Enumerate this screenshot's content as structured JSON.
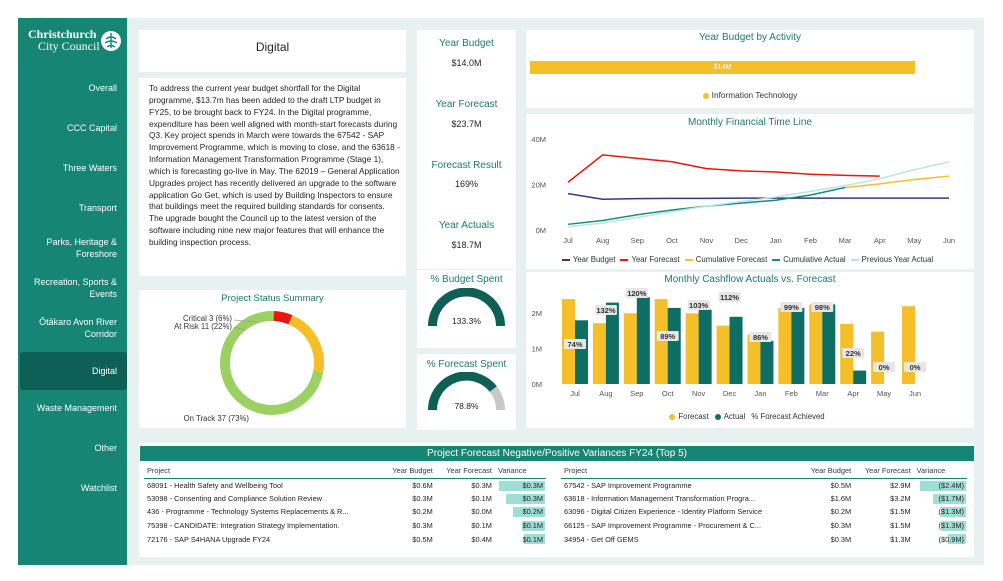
{
  "logo": {
    "line1": "Christchurch",
    "line2": "City Council"
  },
  "nav": [
    {
      "label": "Overall",
      "active": false
    },
    {
      "label": "CCC Capital",
      "active": false
    },
    {
      "label": "Three Waters",
      "active": false
    },
    {
      "label": "Transport",
      "active": false
    },
    {
      "label": "Parks, Heritage & Foreshore",
      "active": false
    },
    {
      "label": "Recreation, Sports & Events",
      "active": false
    },
    {
      "label": "Ōtākaro Avon River Corridor",
      "active": false
    },
    {
      "label": "Digital",
      "active": true
    },
    {
      "label": "Waste Management",
      "active": false
    },
    {
      "label": "Other",
      "active": false
    },
    {
      "label": "Watchlist",
      "active": false
    }
  ],
  "page": {
    "title": "Digital",
    "description": "To address the current year budget shortfall for the Digital programme, $13.7m has been added to the draft LTP budget in FY25, to be brought back to FY24. In the Digital programme, expenditure has been well aligned with month-start forecasts during Q3. Key project spends in March were towards the 67542 - SAP Improvement Programme, which is moving to close, and the 63618 - Information Management Transformation Programme (Stage 1), which is forecasting go-live in May. The 62019 – General Application Upgrades project has recently delivered an upgrade to the software application Go Get, which is used by Building Inspectors to ensure that buildings meet the required building standards for consents. The upgrade bought the Council up to the latest version of the software including nine new major features that will enhance the building inspection process."
  },
  "status_summary": {
    "title": "Project Status Summary",
    "segments": [
      {
        "label": "Critical 3 (6%)",
        "value": 3,
        "color": "#e8170f"
      },
      {
        "label": "At Risk 11 (22%)",
        "value": 11,
        "color": "#f5bf2a"
      },
      {
        "label": "On Track 37 (73%)",
        "value": 37,
        "color": "#9bd063"
      }
    ]
  },
  "kpis": [
    {
      "label": "Year Budget",
      "value": "$14.0M"
    },
    {
      "label": "Year Forecast",
      "value": "$23.7M"
    },
    {
      "label": "Forecast Result",
      "value": "169%"
    },
    {
      "label": "Year Actuals",
      "value": "$18.7M"
    }
  ],
  "gauges": [
    {
      "label": "% Budget Spent",
      "value_text": "133.3%",
      "fraction": 1.0
    },
    {
      "label": "% Forecast Spent",
      "value_text": "78.8%",
      "fraction": 0.788
    }
  ],
  "activity": {
    "title": "Year Budget by Activity",
    "bar_label": "$14M",
    "legend": "Information Technology",
    "color": "#f5bf2a"
  },
  "timeline": {
    "title": "Monthly Financial Time Line",
    "legend": [
      "Year Budget",
      "Year Forecast",
      "Cumulative Forecast",
      "Cumulative Actual",
      "Previous Year Actual"
    ],
    "colors": [
      "#2e3a82",
      "#e8170f",
      "#f5bf2a",
      "#1a8c7c",
      "#bde4e4"
    ]
  },
  "cashflow": {
    "title": "Monthly Cashflow Actuals vs. Forecast",
    "legend": [
      "Forecast",
      "Actual",
      "% Forecast Achieved"
    ],
    "colors": [
      "#f5bf2a",
      "#0e6e63"
    ]
  },
  "chart_data": [
    {
      "type": "bar",
      "title": "Year Budget by Activity",
      "categories": [
        "Information Technology"
      ],
      "values": [
        14
      ],
      "data_labels": [
        "$14M"
      ]
    },
    {
      "type": "line",
      "title": "Monthly Financial Time Line",
      "x": [
        "Jul",
        "Aug",
        "Sep",
        "Oct",
        "Nov",
        "Dec",
        "Jan",
        "Feb",
        "Mar",
        "Apr",
        "May",
        "Jun"
      ],
      "yticks": [
        "0M",
        "20M",
        "40M"
      ],
      "ylim": [
        0,
        40
      ],
      "series": [
        {
          "name": "Year Budget",
          "values": [
            16,
            13.5,
            13.8,
            13.9,
            13.9,
            14,
            14,
            14,
            14,
            14,
            14,
            14
          ]
        },
        {
          "name": "Year Forecast",
          "values": [
            21,
            33,
            31.5,
            30,
            27,
            26,
            25.5,
            24.5,
            24,
            23.7,
            null,
            null
          ]
        },
        {
          "name": "Cumulative Forecast",
          "values": [
            null,
            null,
            null,
            null,
            null,
            null,
            null,
            null,
            18.7,
            20.3,
            22.2,
            23.7
          ]
        },
        {
          "name": "Cumulative Actual",
          "values": [
            2.5,
            4.2,
            6.7,
            8.8,
            10.5,
            11.8,
            13.1,
            15.4,
            18.7,
            null,
            null,
            null
          ]
        },
        {
          "name": "Previous Year Actual",
          "values": [
            1.5,
            3,
            5.5,
            8,
            10.5,
            12.5,
            14.5,
            17,
            19.5,
            22.5,
            26.5,
            30
          ]
        }
      ]
    },
    {
      "type": "bar",
      "title": "Monthly Cashflow Actuals vs. Forecast",
      "categories": [
        "Jul",
        "Aug",
        "Sep",
        "Oct",
        "Nov",
        "Dec",
        "Jan",
        "Feb",
        "Mar",
        "Apr",
        "May",
        "Jun"
      ],
      "yticks": [
        "0M",
        "1M",
        "2M"
      ],
      "ylim": [
        0,
        2.6
      ],
      "series": [
        {
          "name": "Forecast",
          "values": [
            2.4,
            1.72,
            2.0,
            2.4,
            2.0,
            1.65,
            1.4,
            2.15,
            2.25,
            1.7,
            1.48,
            2.2
          ]
        },
        {
          "name": "Actual",
          "values": [
            1.8,
            2.3,
            2.45,
            2.15,
            2.1,
            1.9,
            1.22,
            2.15,
            2.25,
            0.38,
            0,
            0
          ]
        }
      ],
      "data_labels": [
        "74%",
        "132%",
        "120%",
        "89%",
        "103%",
        "112%",
        "86%",
        "99%",
        "98%",
        "22%",
        "0%",
        "0%"
      ]
    }
  ],
  "variance": {
    "title": "Project Forecast Negative/Positive Variances FY24 (Top 5)",
    "columns": [
      "Project",
      "Year Budget",
      "Year Forecast",
      "Variance"
    ],
    "left": [
      {
        "project": "68091 - Health Safety and Wellbeing Tool",
        "budget": "$0.6M",
        "forecast": "$0.3M",
        "variance": "$0.3M",
        "frac": 1.0
      },
      {
        "project": "53098 - Consenting and Compliance Solution Review",
        "budget": "$0.3M",
        "forecast": "$0.1M",
        "variance": "$0.3M",
        "frac": 0.85
      },
      {
        "project": "436 - Programme - Technology Systems Replacements & R...",
        "budget": "$0.2M",
        "forecast": "$0.0M",
        "variance": "$0.2M",
        "frac": 0.7
      },
      {
        "project": "75398 - CANDIDATE: Integration Strategy Implementation.",
        "budget": "$0.3M",
        "forecast": "$0.1M",
        "variance": "$0.1M",
        "frac": 0.5
      },
      {
        "project": "72176 - SAP S4HANA Upgrade FY24",
        "budget": "$0.5M",
        "forecast": "$0.4M",
        "variance": "$0.1M",
        "frac": 0.45
      }
    ],
    "right": [
      {
        "project": "67542 - SAP Improvement Programme",
        "budget": "$0.5M",
        "forecast": "$2.9M",
        "variance": "($2.4M)",
        "frac": 1.0
      },
      {
        "project": "63618 - Information Management Transformation Progra...",
        "budget": "$1.6M",
        "forecast": "$3.2M",
        "variance": "($1.7M)",
        "frac": 0.72
      },
      {
        "project": "63096 - Digital Citizen Experience - Identity Platform Service",
        "budget": "$0.2M",
        "forecast": "$1.5M",
        "variance": "($1.3M)",
        "frac": 0.55
      },
      {
        "project": "66125 - SAP Improvement Programme  -  Procurement & C...",
        "budget": "$0.3M",
        "forecast": "$1.5M",
        "variance": "($1.3M)",
        "frac": 0.55
      },
      {
        "project": "34954 - Get Off GEMS",
        "budget": "$0.3M",
        "forecast": "$1.3M",
        "variance": "($0.9M)",
        "frac": 0.4
      }
    ]
  }
}
